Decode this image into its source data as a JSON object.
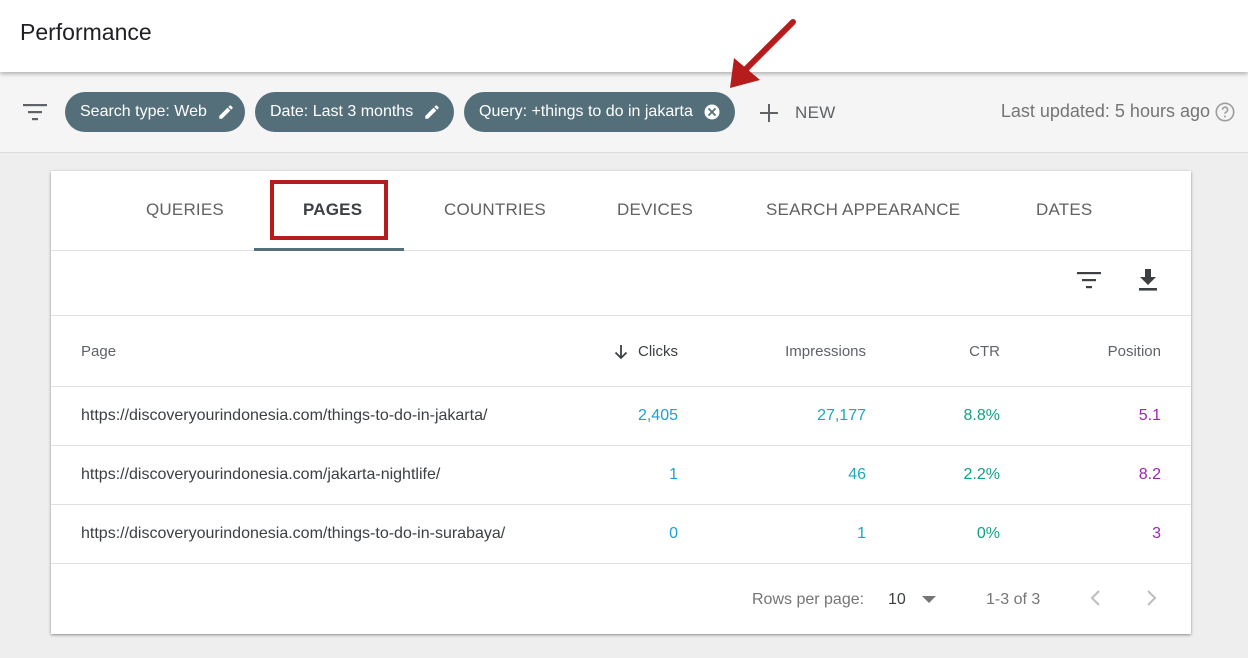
{
  "header": {
    "title": "Performance"
  },
  "filter_bar": {
    "chips": [
      {
        "label": "Search type: Web",
        "action_icon": "pencil-icon"
      },
      {
        "label": "Date: Last 3 months",
        "action_icon": "pencil-icon"
      },
      {
        "label": "Query: +things to do in jakarta",
        "action_icon": "close-circle-icon"
      }
    ],
    "new_label": "NEW",
    "last_updated": "Last updated: 5 hours ago"
  },
  "tabs": [
    {
      "label": "QUERIES",
      "active": false
    },
    {
      "label": "PAGES",
      "active": true
    },
    {
      "label": "COUNTRIES",
      "active": false
    },
    {
      "label": "DEVICES",
      "active": false
    },
    {
      "label": "SEARCH APPEARANCE",
      "active": false
    },
    {
      "label": "DATES",
      "active": false
    }
  ],
  "table": {
    "columns": {
      "page": "Page",
      "clicks": "Clicks",
      "impressions": "Impressions",
      "ctr": "CTR",
      "position": "Position"
    },
    "sorted_column": "clicks",
    "sort_direction": "descending",
    "rows": [
      {
        "page": "https://discoveryourindonesia.com/things-to-do-in-jakarta/",
        "clicks": "2,405",
        "impressions": "27,177",
        "ctr": "8.8%",
        "position": "5.1"
      },
      {
        "page": "https://discoveryourindonesia.com/jakarta-nightlife/",
        "clicks": "1",
        "impressions": "46",
        "ctr": "2.2%",
        "position": "8.2"
      },
      {
        "page": "https://discoveryourindonesia.com/things-to-do-in-surabaya/",
        "clicks": "0",
        "impressions": "1",
        "ctr": "0%",
        "position": "3"
      }
    ]
  },
  "pagination": {
    "rows_per_page_label": "Rows per page:",
    "rows_per_page_value": "10",
    "range_label": "1-3 of 3"
  },
  "colors": {
    "chip": "#546e7a",
    "clicks": "#1a9fd6",
    "impressions": "#1aa9b8",
    "ctr": "#12a085",
    "position": "#9c27b0",
    "annotation": "#b71c1c"
  }
}
